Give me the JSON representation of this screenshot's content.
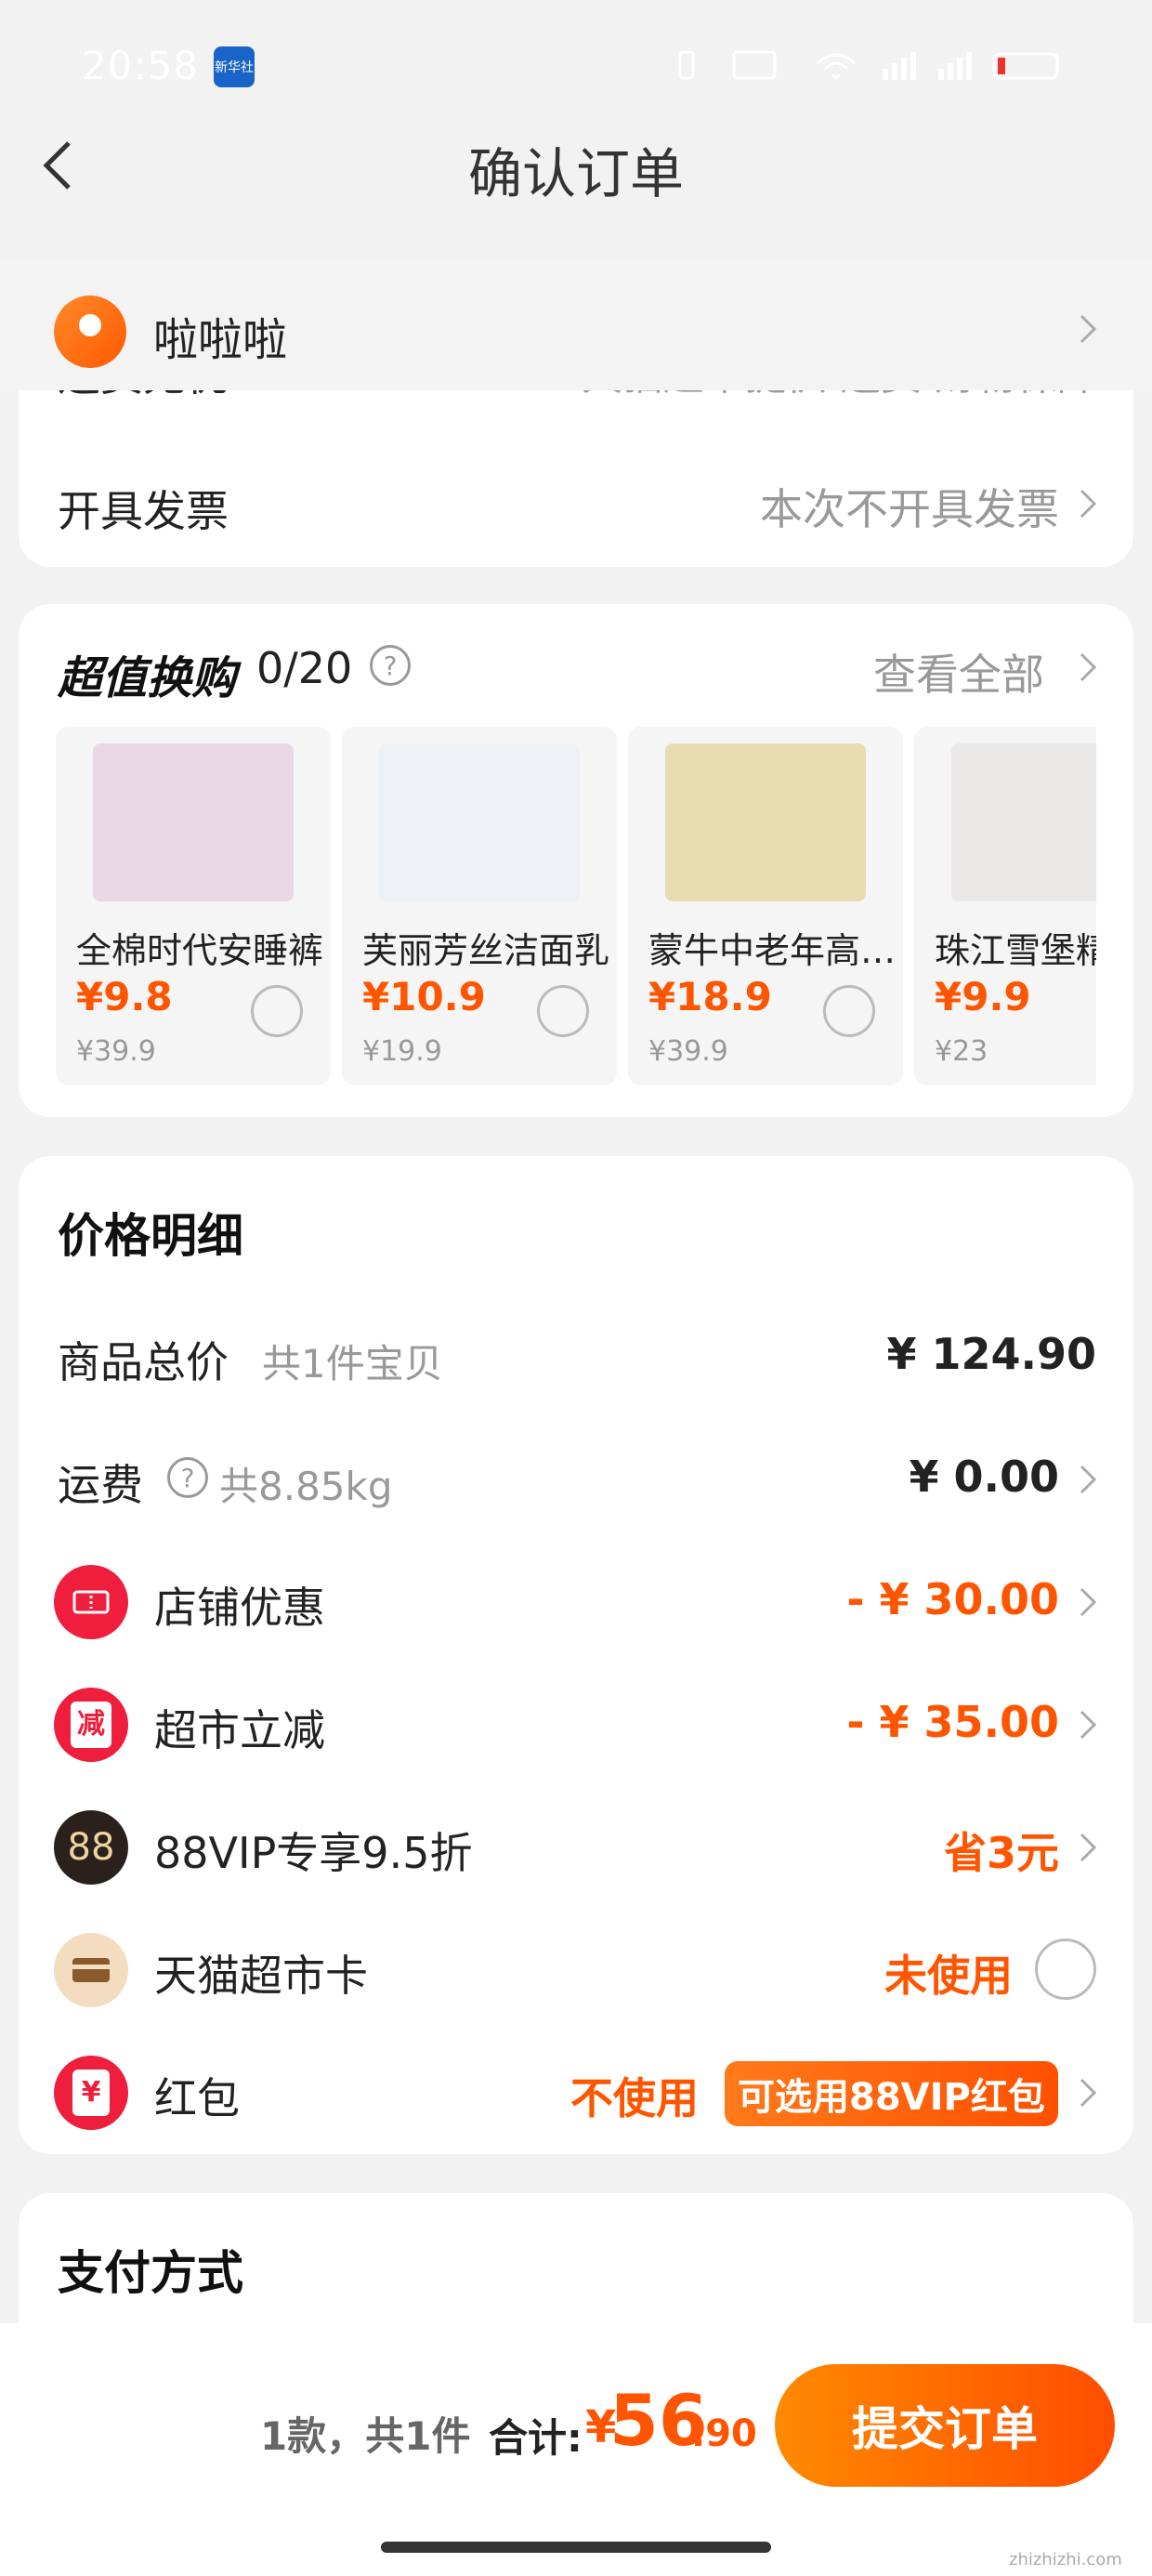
{
  "status_bar": {
    "time": "20:58",
    "app_badge": "新华社"
  },
  "header": {
    "title": "确认订单"
  },
  "address": {
    "name": "啦啦啦"
  },
  "delivery_partial": {
    "label": "运费无忧",
    "value": "天猫超市提供 运费 财物保障"
  },
  "invoice": {
    "label": "开具发票",
    "value": "本次不开具发票"
  },
  "exchange": {
    "title": "超值换购",
    "count": "0/20",
    "view_all": "查看全部",
    "products": [
      {
        "name": "全棉时代安睡裤",
        "price": "¥9.8",
        "orig": "¥39.9",
        "img_color": "#e9d7e6"
      },
      {
        "name": "芙丽芳丝洁面乳",
        "price": "¥10.9",
        "orig": "¥19.9",
        "img_color": "#eef1f4"
      },
      {
        "name": "蒙牛中老年高钙奶粉",
        "price": "¥18.9",
        "orig": "¥39.9",
        "img_color": "#e8dcb0"
      },
      {
        "name": "珠江雪堡精酿",
        "price": "¥9.9",
        "orig": "¥23",
        "img_color": "#eae8e6"
      }
    ]
  },
  "price_detail": {
    "title": "价格明细",
    "total_label": "商品总价",
    "total_sub": "共1件宝贝",
    "total_value": "¥ 124.90",
    "shipping_label": "运费",
    "shipping_sub": "共8.85kg",
    "shipping_value": "¥ 0.00",
    "shop_discount_label": "店铺优惠",
    "shop_discount_value": "- ¥ 30.00",
    "market_cut_label": "超市立减",
    "market_cut_icon": "减",
    "market_cut_value": "- ¥ 35.00",
    "vip_label": "88VIP专享9.5折",
    "vip_icon": "88",
    "vip_value": "省3元",
    "card_label": "天猫超市卡",
    "card_value": "未使用",
    "redpack_label": "红包",
    "redpack_icon": "¥",
    "redpack_value": "不使用",
    "redpack_tag": "可选用88VIP红包"
  },
  "payment": {
    "title": "支付方式"
  },
  "bottom_bar": {
    "summary": "1款，共1件",
    "total_label": "合计:",
    "currency": "¥",
    "amount_int": "56",
    "amount_dec": ".90",
    "submit": "提交订单"
  },
  "watermark": "zhizhizhi.com",
  "colors": {
    "accent": "#ff5500",
    "background": "#f2f2f2"
  }
}
